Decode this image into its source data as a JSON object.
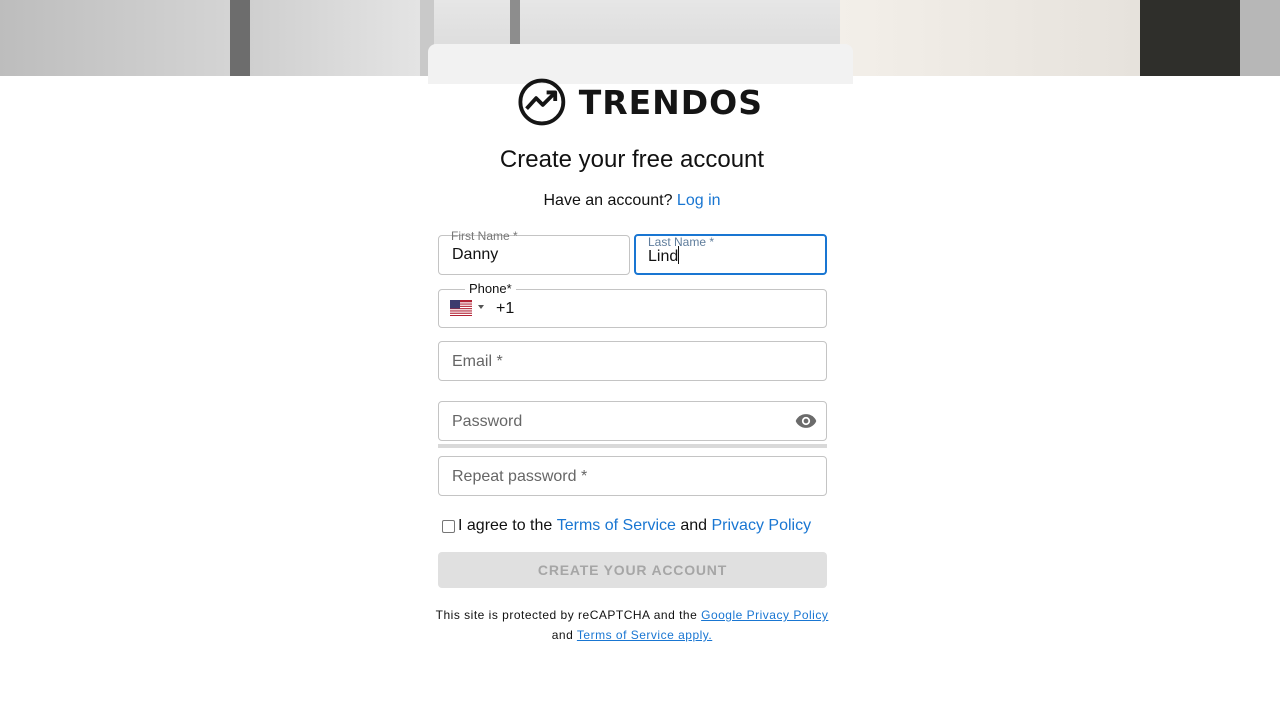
{
  "brand": {
    "name": "TRENDOS",
    "logo_icon": "trend-chart-icon"
  },
  "heading": "Create your free account",
  "login_prompt": {
    "text": "Have an account?",
    "link": "Log in"
  },
  "form": {
    "first_name": {
      "label": "First Name *",
      "value": "Danny"
    },
    "last_name": {
      "label": "Last Name *",
      "value": "Lind"
    },
    "phone": {
      "label": "Phone*",
      "country_flag": "us-flag-icon",
      "dial_code": "+1"
    },
    "email": {
      "placeholder": "Email *"
    },
    "password": {
      "placeholder": "Password",
      "toggle_icon": "eye-icon"
    },
    "repeat_password": {
      "placeholder": "Repeat password *"
    },
    "agree": {
      "text_prefix": "I agree to the",
      "terms_link": "Terms of Service",
      "and": "and",
      "privacy_link": "Privacy Policy",
      "checked": false
    },
    "submit_label": "CREATE YOUR ACCOUNT"
  },
  "recaptcha": {
    "prefix": "This site is protected by reCAPTCHA and the",
    "privacy_link": "Google Privacy Policy",
    "and": "and",
    "terms_link": "Terms of Service apply."
  },
  "colors": {
    "accent": "#1976d2",
    "button_disabled_bg": "#e0e0e0",
    "button_disabled_text": "#a6a6a6"
  }
}
